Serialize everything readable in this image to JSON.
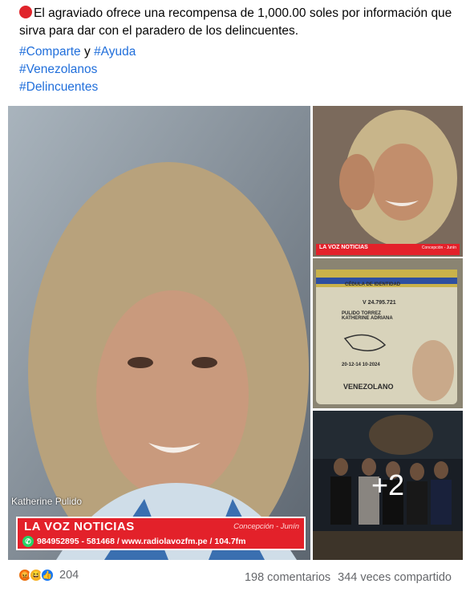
{
  "post": {
    "text": "El agraviado ofrece una recompensa de 1,000.00 soles por información que sirva para dar con el paradero de los delincuentes.",
    "hashtags": {
      "comparte": "#Comparte",
      "conjunction": "y",
      "ayuda": "#Ayuda",
      "venezolanos": "#Venezolanos",
      "delincuentes": "#Delincuentes"
    }
  },
  "gallery": {
    "main_photo": {
      "name": "Katherine Pulido",
      "banner_title": "LA VOZ NOTICIAS",
      "banner_location": "Concepción - Junín",
      "banner_contact": "984952895 - 581468 / www.radiolavozfm.pe / 104.7fm"
    },
    "side_photo_1": {
      "banner_title": "LA VOZ NOTICIAS",
      "banner_location": "Concepción - Junín"
    },
    "id_card": {
      "header": "CÉDULA DE IDENTIDAD",
      "number": "V 24.795.721",
      "name": "PULIDO TORREZ KATHERINE ADRIANA",
      "nationality": "VENEZOLANO",
      "dates": "20-12-14 10-2024"
    },
    "more_count": "+2"
  },
  "footer": {
    "reaction_count": "204",
    "comments": "198 comentarios",
    "shares": "344 veces compartido"
  },
  "colors": {
    "link": "#216fdb",
    "banner_red": "#e3212a",
    "muted": "#65676b"
  }
}
